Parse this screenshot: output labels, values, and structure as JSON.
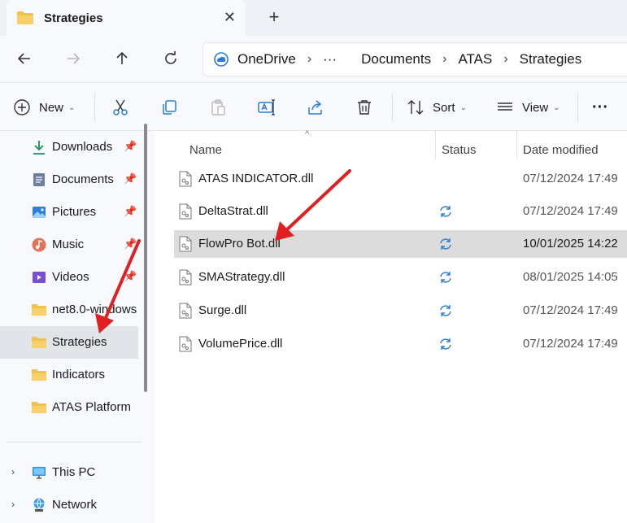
{
  "tab": {
    "title": "Strategies",
    "close_icon": "close-icon",
    "new_tab_icon": "plus-icon"
  },
  "nav": {
    "back_icon": "back-arrow-icon",
    "forward_icon": "forward-arrow-icon",
    "up_icon": "up-arrow-icon",
    "refresh_icon": "refresh-icon"
  },
  "address": {
    "segments": [
      "OneDrive",
      "···",
      "Documents",
      "ATAS",
      "Strategies"
    ],
    "separator": "›"
  },
  "toolbar": {
    "new_label": "New",
    "sort_label": "Sort",
    "view_label": "View",
    "more_label": "···",
    "icons": [
      "cut-icon",
      "copy-icon",
      "paste-icon",
      "rename-icon",
      "share-icon",
      "delete-icon"
    ]
  },
  "sidebar": {
    "items": [
      {
        "label": "Downloads",
        "icon": "download-icon",
        "pinned": true
      },
      {
        "label": "Documents",
        "icon": "documents-icon",
        "pinned": true
      },
      {
        "label": "Pictures",
        "icon": "pictures-icon",
        "pinned": true
      },
      {
        "label": "Music",
        "icon": "music-icon",
        "pinned": true
      },
      {
        "label": "Videos",
        "icon": "videos-icon",
        "pinned": true
      },
      {
        "label": "net8.0-windows",
        "icon": "folder-icon",
        "pinned": false
      },
      {
        "label": "Strategies",
        "icon": "folder-icon",
        "pinned": false,
        "selected": true
      },
      {
        "label": "Indicators",
        "icon": "folder-icon",
        "pinned": false
      },
      {
        "label": "ATAS Platform",
        "icon": "folder-icon",
        "pinned": false
      }
    ],
    "bottom": [
      {
        "label": "This PC",
        "icon": "pc-icon"
      },
      {
        "label": "Network",
        "icon": "network-icon"
      }
    ],
    "pin_glyph": "📌",
    "expand_glyph": "›"
  },
  "columns": {
    "name": "Name",
    "status": "Status",
    "date": "Date modified"
  },
  "files": [
    {
      "name": "ATAS INDICATOR.dll",
      "status": "",
      "date": "07/12/2024 17:49"
    },
    {
      "name": "DeltaStrat.dll",
      "status": "sync",
      "date": "07/12/2024 17:49"
    },
    {
      "name": "FlowPro Bot.dll",
      "status": "sync",
      "date": "10/01/2025 14:22",
      "selected": true
    },
    {
      "name": "SMAStrategy.dll",
      "status": "sync",
      "date": "08/01/2025 14:05"
    },
    {
      "name": "Surge.dll",
      "status": "sync",
      "date": "07/12/2024 17:49"
    },
    {
      "name": "VolumePrice.dll",
      "status": "sync",
      "date": "07/12/2024 17:49"
    }
  ],
  "colors": {
    "accent": "#2c7bd6",
    "annotation_arrow": "#e02020",
    "folder": "#f2c14e",
    "selected_bg": "#dcdcdc"
  }
}
